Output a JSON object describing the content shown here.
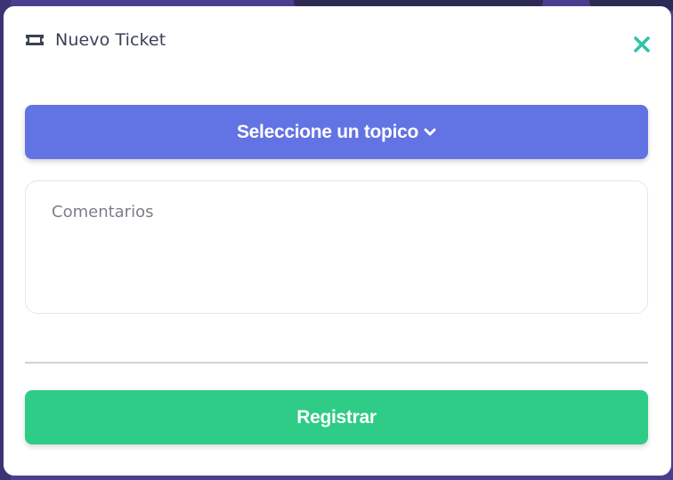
{
  "modal": {
    "title": "Nuevo Ticket",
    "title_icon": "ticket-icon",
    "close_icon": "close-icon",
    "topic_select_label": "Seleccione un topico",
    "topic_select_icon": "chevron-down-icon",
    "comments_placeholder": "Comentarios",
    "comments_value": "",
    "register_label": "Registrar"
  },
  "colors": {
    "backdrop": "#4a3f8e",
    "primary": "#6273e3",
    "success": "#2ecc87",
    "close": "#2ec4a7",
    "title_text": "#3a4256"
  }
}
